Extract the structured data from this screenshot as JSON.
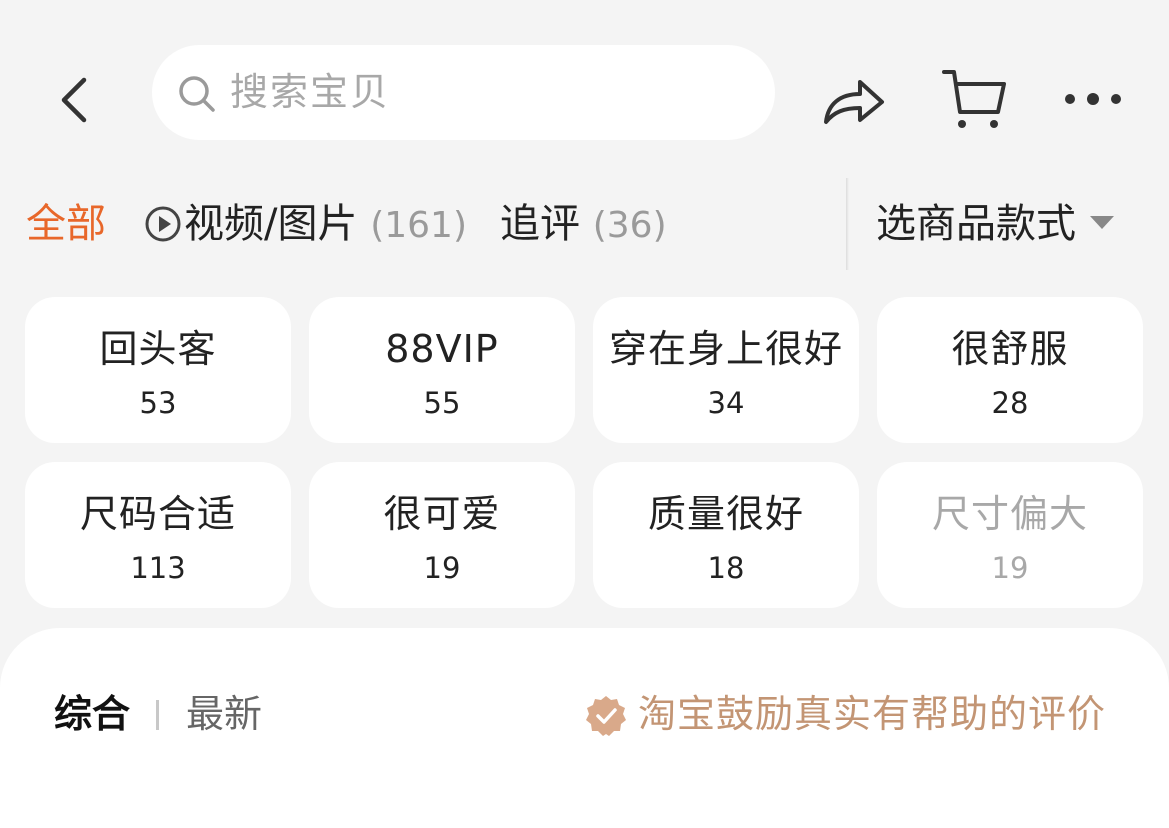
{
  "search": {
    "placeholder": "搜索宝贝"
  },
  "tabs": {
    "all": "全部",
    "media_label": "视频/图片",
    "media_count": "(161)",
    "followup_label": "追评",
    "followup_count": "(36)",
    "sku_select": "选商品款式"
  },
  "tags": [
    {
      "label": "回头客",
      "count": "53"
    },
    {
      "label": "88VIP",
      "count": "55"
    },
    {
      "label": "穿在身上很好",
      "count": "34"
    },
    {
      "label": "很舒服",
      "count": "28"
    },
    {
      "label": "尺码合适",
      "count": "113"
    },
    {
      "label": "很可爱",
      "count": "19"
    },
    {
      "label": "质量很好",
      "count": "18"
    },
    {
      "label": "尺寸偏大",
      "count": "19"
    }
  ],
  "sort": {
    "combined": "综合",
    "latest": "最新"
  },
  "encourage_text": "淘宝鼓励真实有帮助的评价",
  "colors": {
    "accent": "#e8672a",
    "badge": "#d9a98a",
    "encourage_text": "#c39574"
  },
  "icons": [
    "back-arrow-icon",
    "search-icon",
    "share-icon",
    "cart-icon",
    "more-icon",
    "play-icon",
    "verified-badge-icon"
  ]
}
